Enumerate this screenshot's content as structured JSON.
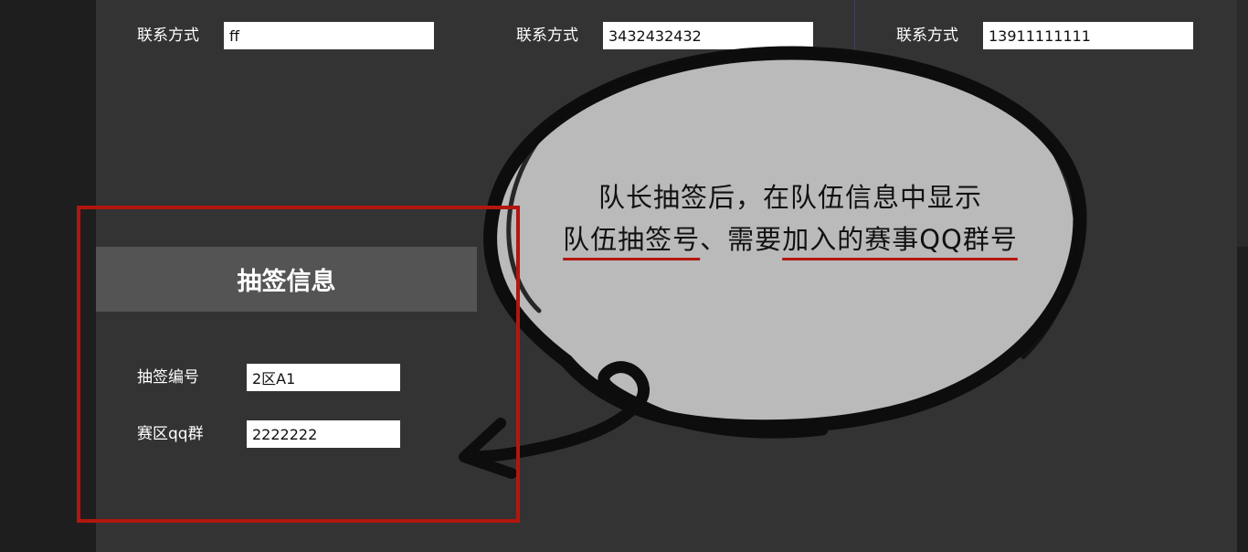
{
  "contacts": [
    {
      "label": "联系方式",
      "value": "ff"
    },
    {
      "label": "联系方式",
      "value": "3432432432"
    },
    {
      "label": "联系方式",
      "value": "13911111111"
    }
  ],
  "draw_section": {
    "title": "抽签信息",
    "fields": [
      {
        "label": "抽签编号",
        "value": "2区A1"
      },
      {
        "label": "赛区qq群",
        "value": "2222222"
      }
    ]
  },
  "annotation": {
    "line1": "队长抽签后，在队伍信息中显示",
    "line2_part1": "队伍抽签号",
    "line2_part2": "、需要",
    "line2_part3": "加入的赛事QQ群号",
    "highlight_color": "#b3160d"
  }
}
